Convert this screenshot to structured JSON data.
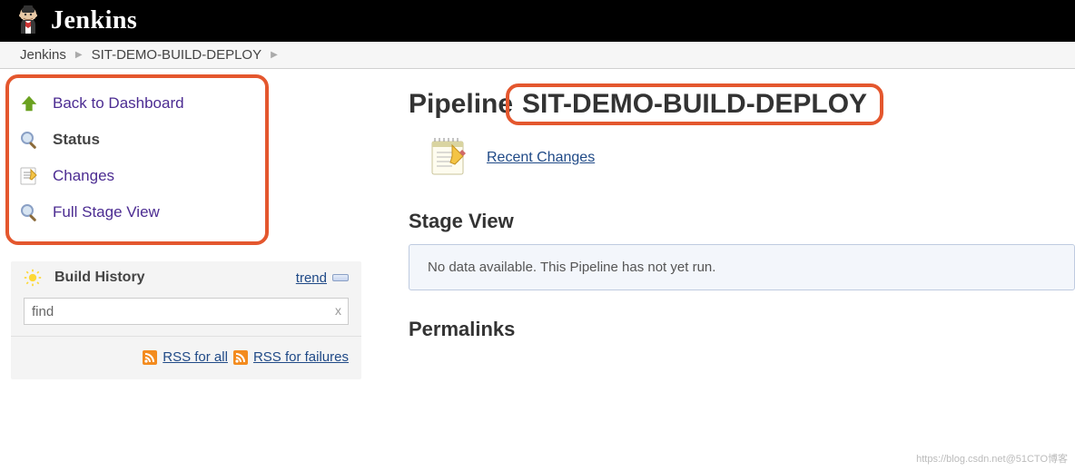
{
  "header": {
    "logo_text": "Jenkins"
  },
  "breadcrumb": {
    "items": [
      {
        "label": "Jenkins"
      },
      {
        "label": "SIT-DEMO-BUILD-DEPLOY"
      }
    ]
  },
  "sidebar": {
    "items": [
      {
        "icon": "arrow-up-icon",
        "label": "Back to Dashboard"
      },
      {
        "icon": "magnifier-icon",
        "label": "Status",
        "current": true
      },
      {
        "icon": "document-icon",
        "label": "Changes"
      },
      {
        "icon": "magnifier-icon",
        "label": "Full Stage View"
      }
    ],
    "build_history": {
      "title": "Build History",
      "trend_label": "trend",
      "find_value": "find",
      "rss_all_label": "RSS for all",
      "rss_failures_label": "RSS for failures"
    }
  },
  "main": {
    "title_prefix": "Pipeline",
    "pipeline_name": "SIT-DEMO-BUILD-DEPLOY",
    "recent_changes_label": "Recent Changes",
    "stage_view_title": "Stage View",
    "no_data_text": "No data available. This Pipeline has not yet run.",
    "permalinks_title": "Permalinks"
  },
  "watermark": "https://blog.csdn.net@51CTO博客"
}
